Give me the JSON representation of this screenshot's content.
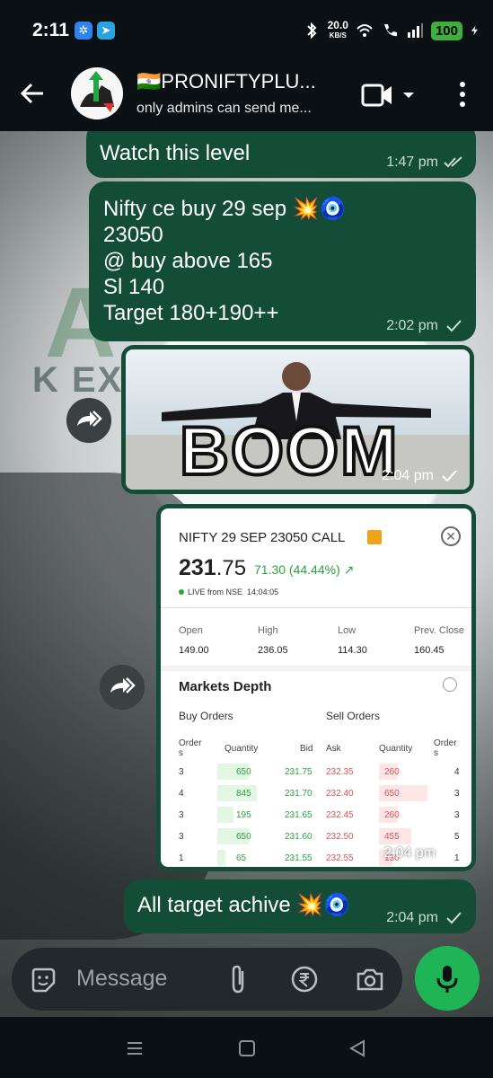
{
  "status_bar": {
    "time": "2:11",
    "net_speed": "20.0",
    "net_unit": "KB/S",
    "battery": "100"
  },
  "header": {
    "title": "🇮🇳PRONIFTYPLU...",
    "subtitle": "only admins can send me..."
  },
  "messages": [
    {
      "text": "Watch this level",
      "time": "1:47 pm"
    },
    {
      "text": "Nifty ce buy 29 sep 💥🧿\n23050\n@ buy above 165\nSl 140\nTarget 180+190++",
      "time": "2:02 pm"
    },
    {
      "type": "image",
      "caption_in_image": "BOOM",
      "time": "2:04 pm"
    },
    {
      "type": "image",
      "time": "2:04 pm"
    },
    {
      "text": "All target achive 💥🧿",
      "time": "2:04 pm"
    }
  ],
  "nifty_card": {
    "title": "NIFTY 29 SEP 23050 CALL",
    "price_int": "231",
    "price_dec": ".75",
    "change": "71.30 (44.44%) ↗",
    "live": "LIVE from NSE",
    "live_time": "14:04:05",
    "ohlc": [
      {
        "label": "Open",
        "value": "149.00"
      },
      {
        "label": "High",
        "value": "236.05"
      },
      {
        "label": "Low",
        "value": "114.30"
      },
      {
        "label": "Prev. Close",
        "value": "160.45"
      }
    ],
    "depth_title": "Markets Depth",
    "buy_orders": "Buy Orders",
    "sell_orders": "Sell Orders",
    "columns": {
      "orders": "Order\ns",
      "quantity": "Quantity",
      "bid": "Bid",
      "ask": "Ask",
      "quantity2": "Quantity",
      "orders2": "Order\ns"
    },
    "rows": [
      {
        "orders": "3",
        "qty": "650",
        "bid": "231.75",
        "ask": "232.35",
        "sqty": "260",
        "sorders": "4",
        "bfill": 0.75,
        "sfill": 0.35
      },
      {
        "orders": "4",
        "qty": "845",
        "bid": "231.70",
        "ask": "232.40",
        "sqty": "650",
        "sorders": "3",
        "bfill": 0.95,
        "sfill": 0.9
      },
      {
        "orders": "3",
        "qty": "195",
        "bid": "231.65",
        "ask": "232.45",
        "sqty": "260",
        "sorders": "3",
        "bfill": 0.4,
        "sfill": 0.35
      },
      {
        "orders": "3",
        "qty": "650",
        "bid": "231.60",
        "ask": "232.50",
        "sqty": "455",
        "sorders": "5",
        "bfill": 0.75,
        "sfill": 0.6
      },
      {
        "orders": "1",
        "qty": "65",
        "bid": "231.55",
        "ask": "232.55",
        "sqty": "130",
        "sorders": "1",
        "bfill": 0.2,
        "sfill": 0.25
      }
    ]
  },
  "background": {
    "letters": "K EXCH",
    "big_letter": "A"
  },
  "input": {
    "placeholder": "Message"
  },
  "colors": {
    "bubble": "#134d37",
    "accent": "#1fb455",
    "dark": "#0b1014"
  }
}
